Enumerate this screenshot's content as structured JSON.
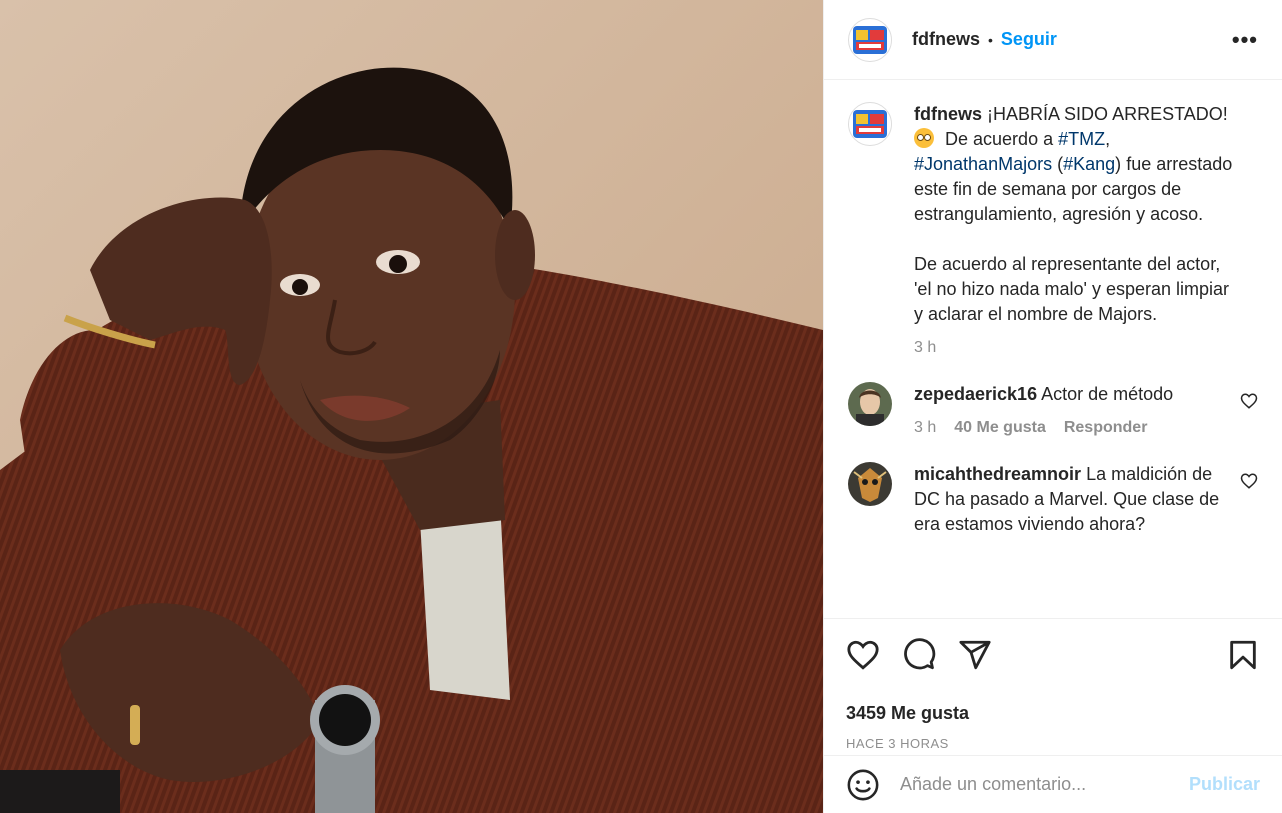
{
  "post": {
    "author": "fdfnews",
    "separator": "•",
    "follow_label": "Seguir",
    "more_label": "•••",
    "caption": {
      "username": "fdfnews",
      "line1": "¡HABRÍA SIDO ARRESTADO!",
      "line2_pre": "De acuerdo a",
      "tag_tmz": "#TMZ",
      "line2_post": ",",
      "tag_majors": "#JonathanMajors",
      "open_paren": "(",
      "tag_kang": "#Kang",
      "close_paren": ")",
      "rest": "fue arrestado este fin de semana por cargos de estrangulamiento, agresión y acoso.",
      "para2": "De acuerdo al representante del actor, 'el no hizo nada malo' y esperan limpiar y aclarar el nombre de Majors.",
      "time": "3 h"
    },
    "comments": [
      {
        "username": "zepedaerick16",
        "text": "Actor de método",
        "time": "3 h",
        "likes": "40 Me gusta",
        "reply": "Responder"
      },
      {
        "username": "micahthedreamnoir",
        "text": "La maldición de DC ha pasado a Marvel. Que clase de era estamos viviendo ahora?"
      }
    ],
    "likes_count": "3459 Me gusta",
    "posted_ago": "HACE 3 HORAS",
    "add_comment_placeholder": "Añade un comentario...",
    "publish_label": "Publicar"
  },
  "icons": {
    "like": "heart-icon",
    "comment": "comment-bubble-icon",
    "share": "paper-plane-icon",
    "save": "bookmark-icon",
    "emoji": "smiley-icon",
    "comment_like": "small-heart-icon"
  },
  "colors": {
    "link": "#0095f6",
    "hashtag": "#00376b",
    "secondary": "#8e8e8e",
    "publish_disabled": "#b2dffc"
  }
}
